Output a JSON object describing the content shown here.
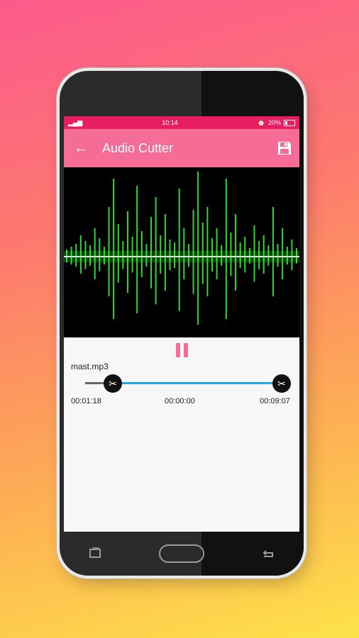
{
  "status_bar": {
    "time": "10:14",
    "battery": "20%"
  },
  "app_bar": {
    "title": "Audio Cutter"
  },
  "player": {
    "file_name": "mast.mp3",
    "start_time": "00:01:18",
    "current_time": "00:00:00",
    "end_time": "00:09:07"
  },
  "colors": {
    "status_bar": "#e81e63",
    "app_bar": "#f56c96",
    "track": "#1eaae0",
    "wave": "#35ff35"
  },
  "icons": [
    "back-arrow-icon",
    "save-icon",
    "pause-icon",
    "scissors-icon",
    "recent-apps-icon",
    "home-icon",
    "back-icon"
  ]
}
